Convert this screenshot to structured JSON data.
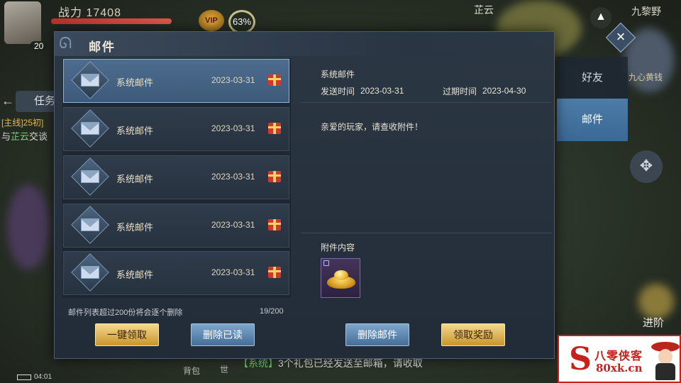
{
  "hud": {
    "level": "20",
    "power_label": "战力",
    "power_value": "17408",
    "vip_label": "VIP",
    "progress_pct": "63%",
    "top_name": "芷云",
    "top_right_name": "九黎野",
    "task_tab": "任务",
    "quest_line1": "[主线]25初]",
    "quest_line2_prefix": "与",
    "quest_line2_name": "芷云",
    "quest_line2_suffix": "交谈",
    "right_name": "九心黄钱",
    "advance_label": "进阶",
    "time": "04:01",
    "bag_label": "背包",
    "world_label": "世",
    "chat_channel": "【系统】",
    "chat_text": "3个礼包已经发送至邮箱，请收取"
  },
  "dialog": {
    "title": "邮件",
    "close_symbol": "×",
    "side_tabs": [
      {
        "label": "好友",
        "active": false
      },
      {
        "label": "邮件",
        "active": true
      }
    ],
    "mails": [
      {
        "name": "系统邮件",
        "date": "2023-03-31",
        "has_attachment": true,
        "selected": true
      },
      {
        "name": "系统邮件",
        "date": "2023-03-31",
        "has_attachment": true,
        "selected": false
      },
      {
        "name": "系统邮件",
        "date": "2023-03-31",
        "has_attachment": true,
        "selected": false
      },
      {
        "name": "系统邮件",
        "date": "2023-03-31",
        "has_attachment": true,
        "selected": false
      },
      {
        "name": "系统邮件",
        "date": "2023-03-31",
        "has_attachment": true,
        "selected": false
      }
    ],
    "list_note": "邮件列表超过200份将会逐个删除",
    "list_count": "19/200",
    "detail": {
      "sender": "系统邮件",
      "sent_label": "发送时间",
      "sent_date": "2023-03-31",
      "expire_label": "过期时间",
      "expire_date": "2023-04-30",
      "body": "亲爱的玩家，请查收附件！",
      "attachment_label": "附件内容",
      "attachment_icon": "gold-ingot-icon"
    },
    "buttons": {
      "claim_all": "一键领取",
      "delete_read": "删除已读",
      "delete_mail": "删除邮件",
      "claim_reward": "领取奖励"
    }
  },
  "watermark": {
    "cn": "八零侠客",
    "url": "80xk.cn"
  },
  "colors": {
    "accent_blue": "#3b6894",
    "gold_button": "#c9952e",
    "gift_red": "#d8342c",
    "watermark_red": "#c8201a"
  }
}
